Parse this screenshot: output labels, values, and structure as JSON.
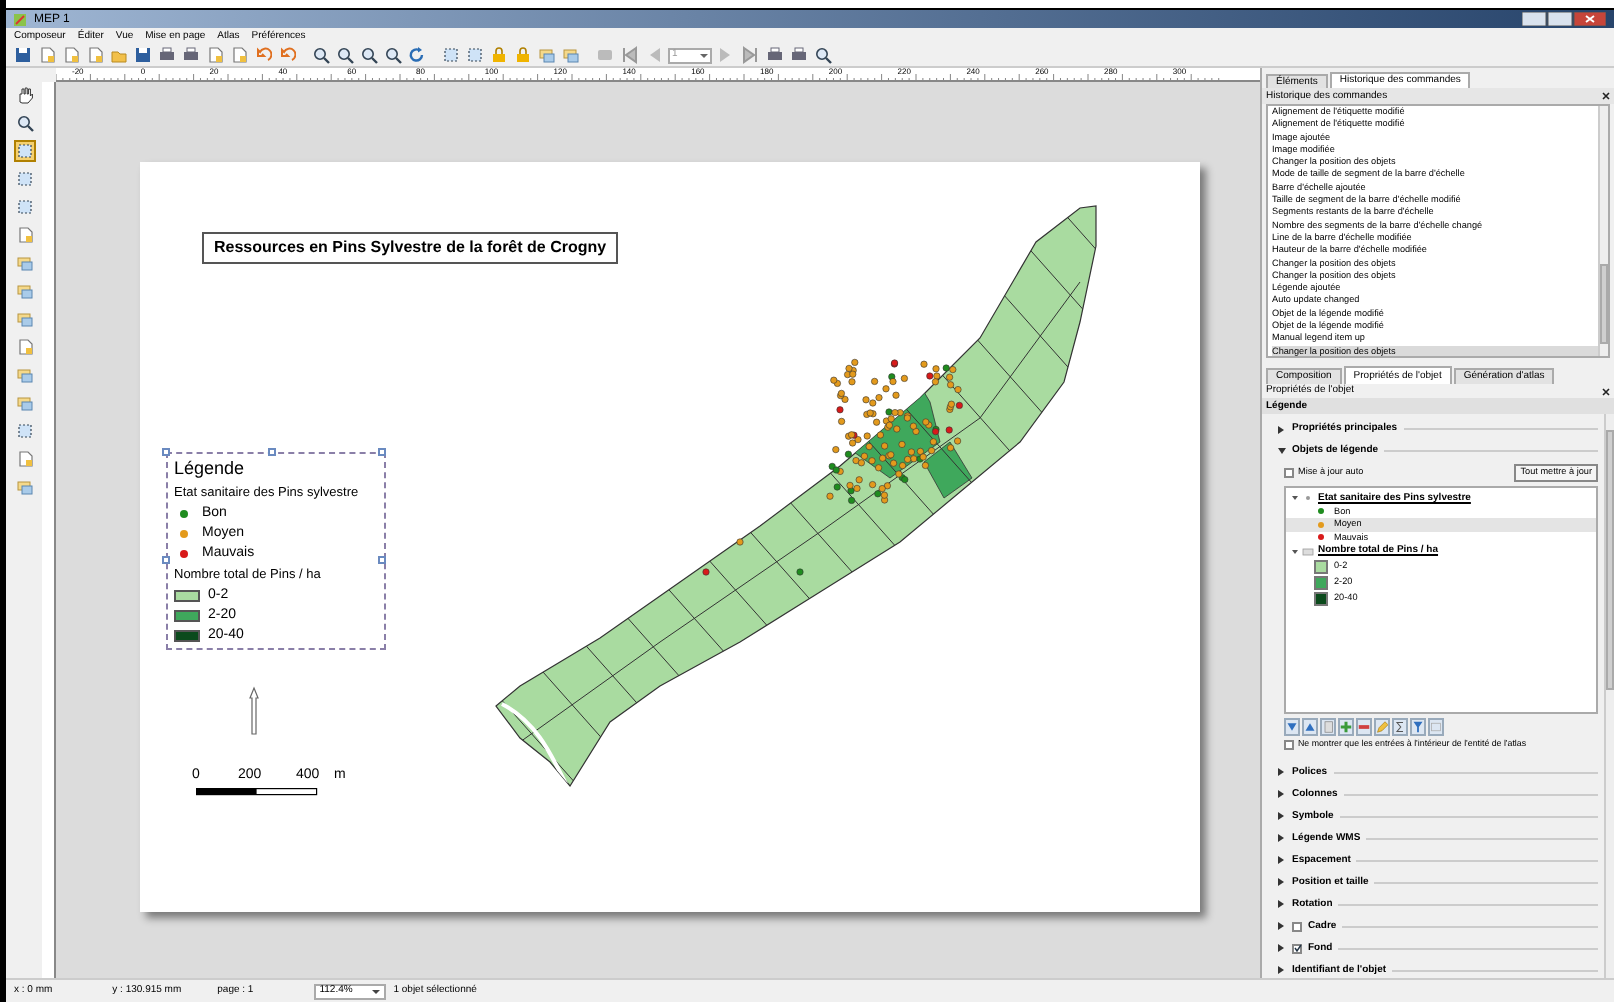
{
  "window": {
    "title": "MEP 1"
  },
  "menu": [
    "Composeur",
    "Éditer",
    "Vue",
    "Mise en page",
    "Atlas",
    "Préférences"
  ],
  "toolbar": {
    "page_field": "1"
  },
  "ruler": {
    "labels": [
      "-20",
      "0",
      "20",
      "40",
      "60",
      "80",
      "100",
      "120",
      "140",
      "160",
      "180",
      "200",
      "220",
      "240",
      "260",
      "280",
      "300"
    ]
  },
  "page": {
    "title": "Ressources en Pins Sylvestre de la forêt de Crogny",
    "legend": {
      "title": "Légende",
      "groups": [
        {
          "title": "Etat sanitaire des Pins sylvestre",
          "kind": "point",
          "items": [
            {
              "label": "Bon",
              "color": "#1f8c1f"
            },
            {
              "label": "Moyen",
              "color": "#e39a1c"
            },
            {
              "label": "Mauvais",
              "color": "#d81a1a"
            }
          ]
        },
        {
          "title": "Nombre total de Pins / ha",
          "kind": "area",
          "items": [
            {
              "label": "0-2",
              "color": "#a9dba0"
            },
            {
              "label": "2-20",
              "color": "#3fa85c"
            },
            {
              "label": "20-40",
              "color": "#0b4a1c"
            }
          ]
        }
      ]
    },
    "scale_bar": {
      "labels": [
        "0",
        "200",
        "400",
        "m"
      ]
    }
  },
  "top_panel": {
    "tabs": [
      {
        "label": "Éléments",
        "selected": false
      },
      {
        "label": "Historique des commandes",
        "selected": true
      }
    ],
    "title": "Historique des commandes",
    "history": [
      {
        "label": "Alignement de l'étiquette modifié",
        "selected": false
      },
      {
        "label": "Alignement de l'étiquette modifié",
        "selected": false
      },
      {
        "label": "Image ajoutée",
        "selected": false
      },
      {
        "label": "Image modifiée",
        "selected": false
      },
      {
        "label": "Changer la position des objets",
        "selected": false
      },
      {
        "label": "Mode de taille de segment de la barre d'échelle",
        "selected": false
      },
      {
        "label": "Barre d'échelle ajoutée",
        "selected": false
      },
      {
        "label": "Taille de segment de la barre d'échelle modifié",
        "selected": false
      },
      {
        "label": "Segments restants de la barre d'échelle",
        "selected": false
      },
      {
        "label": "Nombre des segments de la barre d'échelle changé",
        "selected": false
      },
      {
        "label": "Line de la barre d'échelle modifiée",
        "selected": false
      },
      {
        "label": "Hauteur de la barre d'échelle modifiée",
        "selected": false
      },
      {
        "label": "Changer la position des objets",
        "selected": false
      },
      {
        "label": "Changer la position des objets",
        "selected": false
      },
      {
        "label": "Légende ajoutée",
        "selected": false
      },
      {
        "label": "Auto update changed",
        "selected": false
      },
      {
        "label": "Objet de la légende modifié",
        "selected": false
      },
      {
        "label": "Objet de la légende modifié",
        "selected": false
      },
      {
        "label": "Manual legend item up",
        "selected": false
      },
      {
        "label": "Changer la position des objets",
        "selected": true
      }
    ]
  },
  "bottom_panel": {
    "tabs": [
      {
        "label": "Composition",
        "selected": false
      },
      {
        "label": "Propriétés de l'objet",
        "selected": true
      },
      {
        "label": "Génération d'atlas",
        "selected": false
      }
    ],
    "title": "Propriétés de l'objet",
    "item_type": "Légende",
    "main_section": {
      "label": "Propriétés principales",
      "expanded": false
    },
    "items_section": {
      "label": "Objets de légende",
      "expanded": true,
      "auto_update": {
        "label": "Mise à jour auto",
        "checked": false
      },
      "update_all_button": "Tout mettre à jour",
      "tree": [
        {
          "label": "Etat sanitaire des Pins sylvestre",
          "kind": "point",
          "children": [
            {
              "label": "Bon",
              "color": "#1f8c1f",
              "selected": false
            },
            {
              "label": "Moyen",
              "color": "#e39a1c",
              "selected": true
            },
            {
              "label": "Mauvais",
              "color": "#d81a1a",
              "selected": false
            }
          ]
        },
        {
          "label": "Nombre total de Pins / ha",
          "kind": "area",
          "children": [
            {
              "label": "0-2",
              "color": "#a9dba0",
              "selected": false
            },
            {
              "label": "2-20",
              "color": "#3fa85c",
              "selected": false
            },
            {
              "label": "20-40",
              "color": "#0b4a1c",
              "selected": false
            }
          ]
        }
      ],
      "atlas_filter": {
        "label": "Ne montrer que les entrées à l'intérieur de l'entité de l'atlas",
        "checked": false
      }
    },
    "sections": [
      {
        "label": "Polices",
        "kind": "plain"
      },
      {
        "label": "Colonnes",
        "kind": "plain"
      },
      {
        "label": "Symbole",
        "kind": "plain"
      },
      {
        "label": "Légende WMS",
        "kind": "plain"
      },
      {
        "label": "Espacement",
        "kind": "plain"
      },
      {
        "label": "Position et taille",
        "kind": "plain"
      },
      {
        "label": "Rotation",
        "kind": "plain"
      },
      {
        "label": "Cadre",
        "kind": "checkbox",
        "checked": false
      },
      {
        "label": "Fond",
        "kind": "checkbox",
        "checked": true
      },
      {
        "label": "Identifiant de l'objet",
        "kind": "plain"
      }
    ]
  },
  "status_bar": {
    "x": "x : 0 mm",
    "y": "y : 130.915 mm",
    "page": "page : 1",
    "zoom": "112.4%",
    "selection": "1 objet sélectionné"
  }
}
